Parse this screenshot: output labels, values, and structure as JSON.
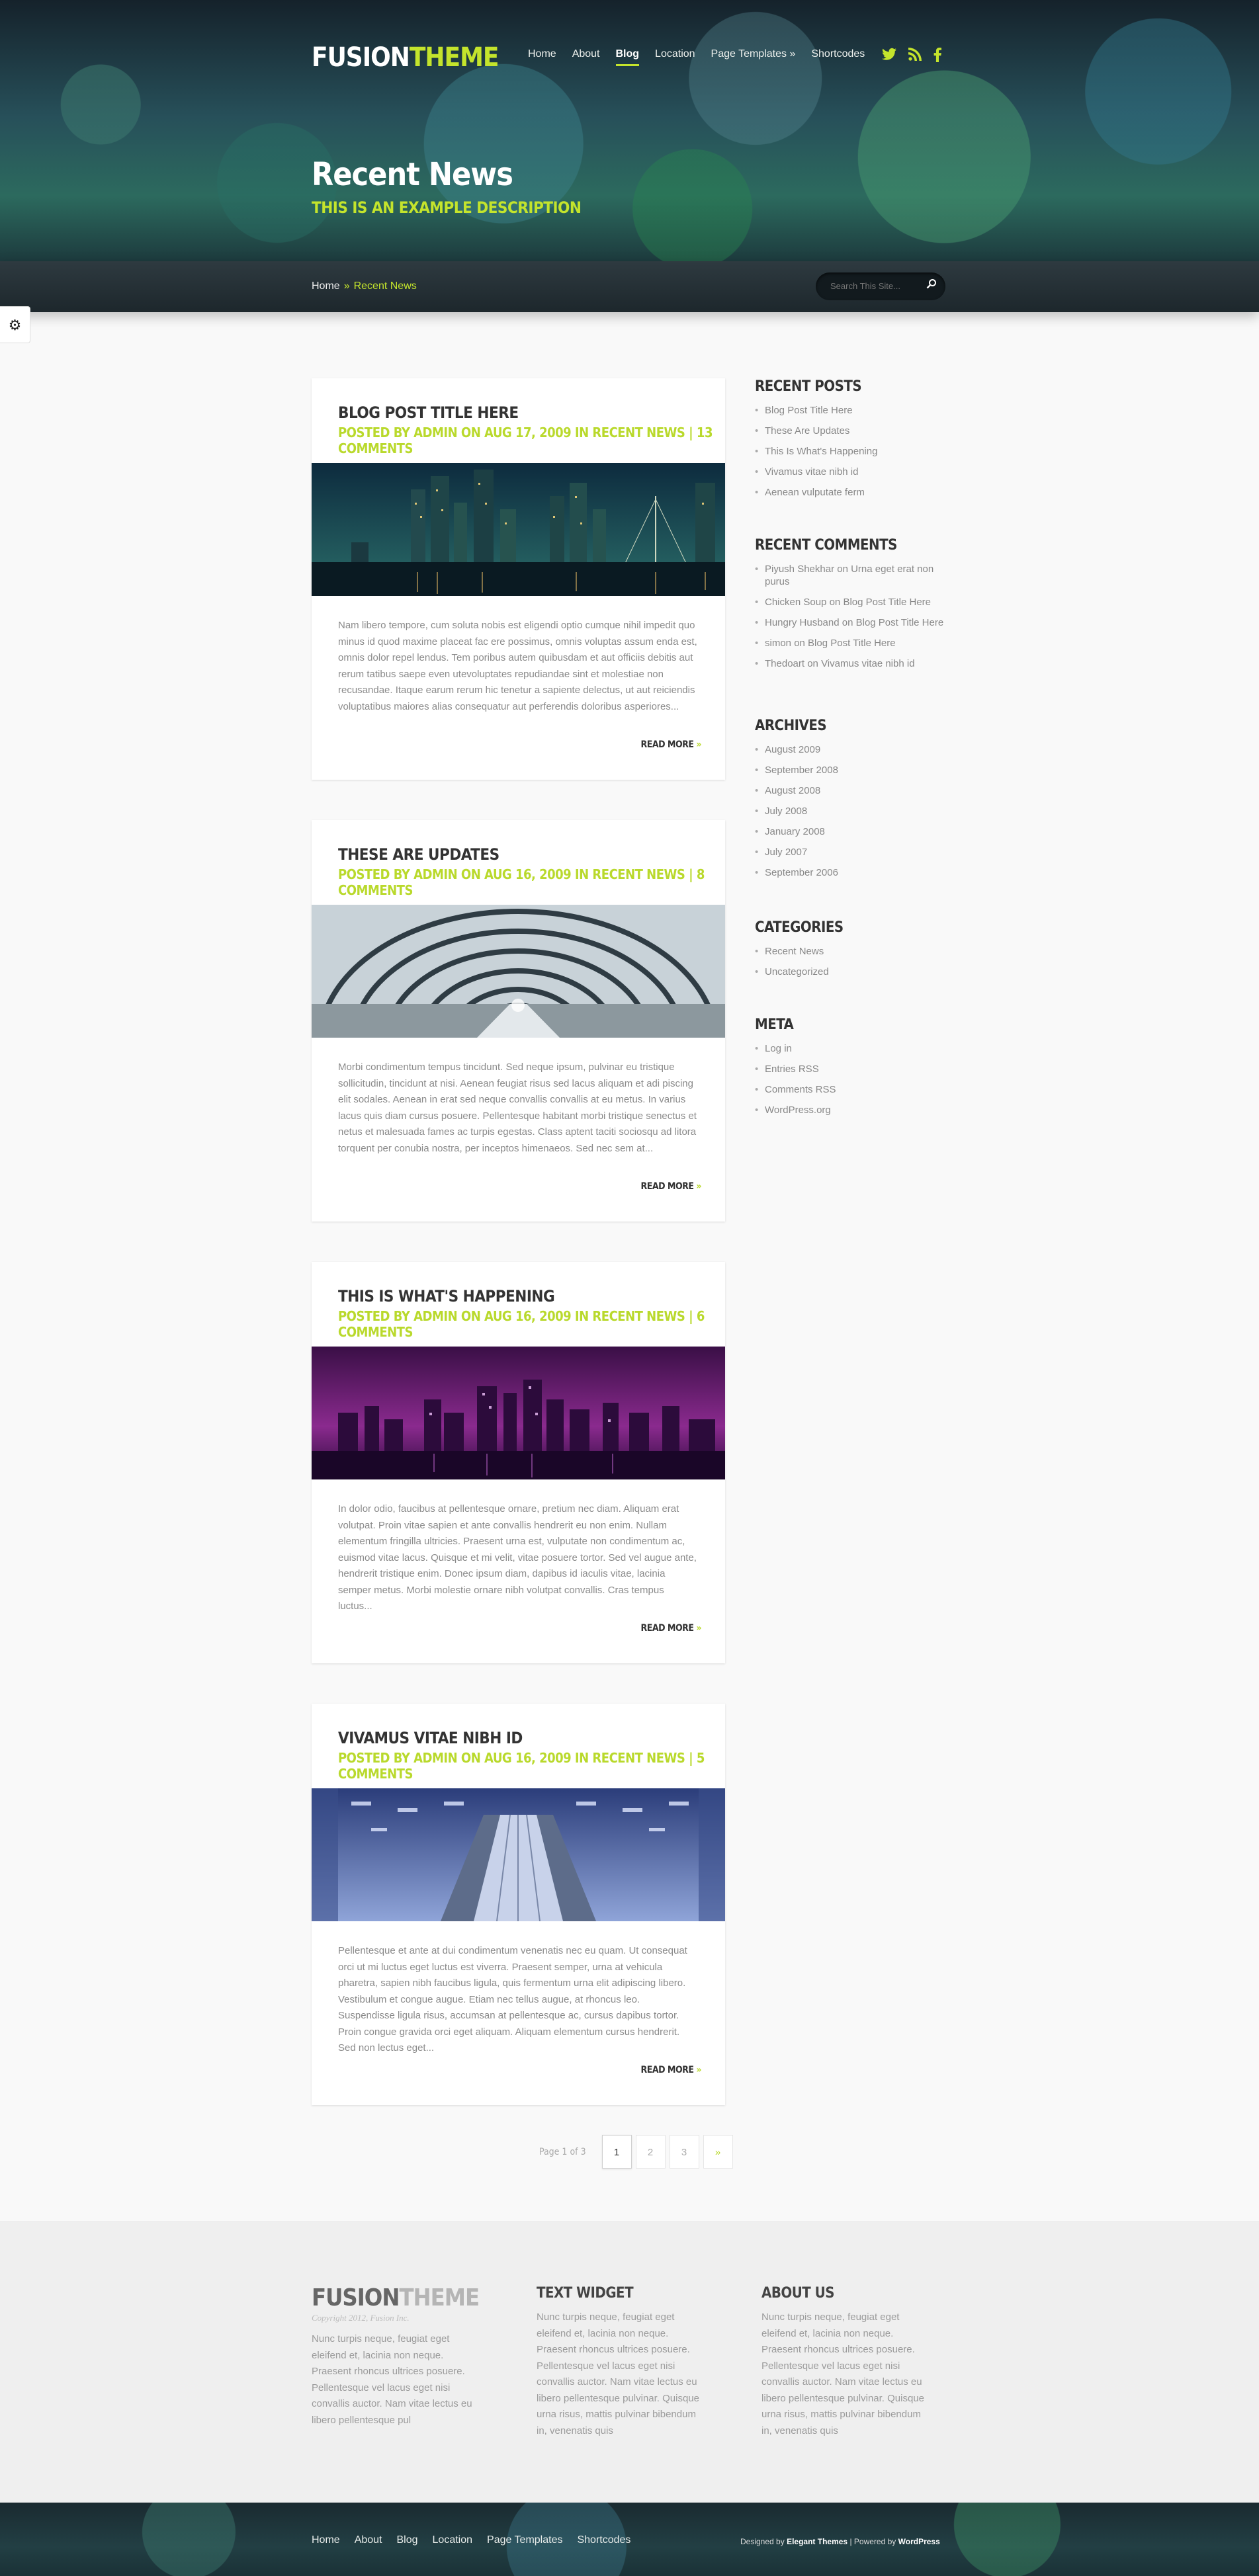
{
  "header": {
    "logo_main": "FUSION",
    "logo_accent": "THEME",
    "nav": [
      "Home",
      "About",
      "Blog",
      "Location",
      "Page Templates",
      "Shortcodes"
    ],
    "nav_active_index": 2,
    "nav_submenu_marker": "»",
    "social_icons": [
      "twitter-icon",
      "rss-icon",
      "facebook-icon"
    ],
    "page_title": "Recent News",
    "page_description": "THIS IS AN EXAMPLE DESCRIPTION"
  },
  "breadcrumb": {
    "home": "Home",
    "separator": "»",
    "current": "Recent News"
  },
  "search": {
    "placeholder": "Search This Site..."
  },
  "posts": [
    {
      "title": "BLOG POST TITLE HERE",
      "meta": "POSTED BY ADMIN ON AUG 17, 2009 IN RECENT NEWS | 13 COMMENTS",
      "image": "city-night-skyline",
      "excerpt": "Nam libero tempore, cum soluta nobis est eligendi optio cumque nihil impedit quo minus id quod maxime placeat fac ere possimus, omnis voluptas assum enda est, omnis dolor repel lendus. Tem poribus autem quibusdam et aut officiis debitis aut rerum tatibus saepe even utevoluptates repudiandae sint et molestiae non recusandae. Itaque earum rerum hic tenetur a sapiente delectus, ut aut reiciendis voluptatibus maiores alias consequatur aut perferendis doloribus asperiores...",
      "read_more": "READ MORE"
    },
    {
      "title": "THESE ARE UPDATES",
      "meta": "POSTED BY ADMIN ON AUG 16, 2009 IN RECENT NEWS | 8 COMMENTS",
      "image": "glass-tunnel",
      "excerpt": "Morbi condimentum tempus tincidunt. Sed neque ipsum, pulvinar eu tristique sollicitudin, tincidunt at nisi. Aenean feugiat risus sed lacus aliquam et adi piscing elit sodales. Aenean in erat sed neque convallis convallis at eu metus. In varius lacus quis diam cursus posuere. Pellentesque habitant morbi tristique senectus et netus et malesuada fames ac turpis egestas. Class aptent taciti sociosqu ad litora torquent per conubia nostra, per inceptos himenaeos. Sed nec sem at...",
      "read_more": "READ MORE"
    },
    {
      "title": "THIS IS WHAT'S HAPPENING",
      "meta": "POSTED BY ADMIN ON AUG 16, 2009 IN RECENT NEWS | 6 COMMENTS",
      "image": "purple-city-skyline",
      "excerpt": "In dolor odio, faucibus at pellentesque ornare, pretium nec diam. Aliquam erat volutpat. Proin vitae sapien et ante convallis hendrerit eu non enim. Nullam elementum fringilla ultricies. Praesent urna est, vulputate non condimentum ac, euismod vitae lacus. Quisque et mi velit, vitae posuere tortor. Sed vel augue ante, hendrerit tristique enim. Donec ipsum diam, dapibus id iaculis vitae, lacinia semper metus. Morbi molestie ornare nibh volutpat convallis. Cras tempus luctus...",
      "read_more": "READ MORE"
    },
    {
      "title": "VIVAMUS VITAE NIBH ID",
      "meta": "POSTED BY ADMIN ON AUG 16, 2009 IN RECENT NEWS | 5 COMMENTS",
      "image": "blue-escalator-hall",
      "excerpt": "Pellentesque et ante at dui condimentum venenatis nec eu quam. Ut consequat orci ut mi luctus eget luctus est viverra. Praesent semper, urna at vehicula pharetra, sapien nibh faucibus ligula, quis fermentum urna elit adipiscing libero. Vestibulum et congue augue. Etiam nec tellus augue, at rhoncus leo. Suspendisse ligula risus, accumsan at pellentesque ac, cursus dapibus tortor. Proin congue gravida orci eget aliquam. Aliquam elementum cursus hendrerit. Sed non lectus eget...",
      "read_more": "READ MORE"
    }
  ],
  "sidebar": {
    "recent_posts": {
      "title": "RECENT POSTS",
      "items": [
        "Blog Post Title Here",
        "These Are Updates",
        "This Is What's Happening",
        "Vivamus vitae nibh id",
        "Aenean vulputate ferm"
      ]
    },
    "recent_comments": {
      "title": "RECENT COMMENTS",
      "items": [
        {
          "author": "Piyush Shekhar",
          "connector": "on",
          "post": "Urna eget erat non purus"
        },
        {
          "author": "Chicken Soup",
          "connector": "on",
          "post": "Blog Post Title Here"
        },
        {
          "author": "Hungry Husband",
          "connector": "on",
          "post": "Blog Post Title Here"
        },
        {
          "author": "simon",
          "connector": "on",
          "post": "Blog Post Title Here"
        },
        {
          "author": "Thedoart",
          "connector": "on",
          "post": "Vivamus vitae nibh id"
        }
      ]
    },
    "archives": {
      "title": "ARCHIVES",
      "items": [
        "August 2009",
        "September 2008",
        "August 2008",
        "July 2008",
        "January 2008",
        "July 2007",
        "September 2006"
      ]
    },
    "categories": {
      "title": "CATEGORIES",
      "items": [
        "Recent News",
        "Uncategorized"
      ]
    },
    "meta": {
      "title": "META",
      "items": [
        "Log in",
        "Entries RSS",
        "Comments RSS",
        "WordPress.org"
      ]
    }
  },
  "pagination": {
    "label": "Page 1 of 3",
    "pages": [
      "1",
      "2",
      "3"
    ],
    "current": "1",
    "next": "»"
  },
  "footer": {
    "logo_main": "FUSION",
    "logo_accent": "THEME",
    "copyright": "Copyright 2012, Fusion Inc.",
    "logo_text": "Nunc turpis neque, feugiat eget eleifend et, lacinia non neque. Praesent rhoncus ultrices posuere. Pellentesque vel lacus eget nisi convallis auctor. Nam vitae lectus eu libero pellentesque pul",
    "text_widget": {
      "title": "TEXT WIDGET",
      "text": "Nunc turpis neque, feugiat eget eleifend et, lacinia non neque. Praesent rhoncus ultrices posuere. Pellentesque vel lacus eget nisi convallis auctor. Nam vitae lectus eu libero pellentesque pulvinar. Quisque urna risus, mattis pulvinar bibendum in, venenatis quis"
    },
    "about_us": {
      "title": "ABOUT US",
      "text": "Nunc turpis neque, feugiat eget eleifend et, lacinia non neque. Praesent rhoncus ultrices posuere. Pellentesque vel lacus eget nisi convallis auctor. Nam vitae lectus eu libero pellentesque pulvinar. Quisque urna risus, mattis pulvinar bibendum in, venenatis quis"
    },
    "nav": [
      "Home",
      "About",
      "Blog",
      "Location",
      "Page Templates",
      "Shortcodes"
    ],
    "credits_prefix": "Designed by",
    "credits_designer": "Elegant Themes",
    "credits_separator": "|",
    "credits_powered": "Powered by",
    "credits_platform": "WordPress"
  },
  "colors": {
    "accent": "#c4e42c",
    "heading": "#333333",
    "body_text": "#8a8a8a"
  }
}
